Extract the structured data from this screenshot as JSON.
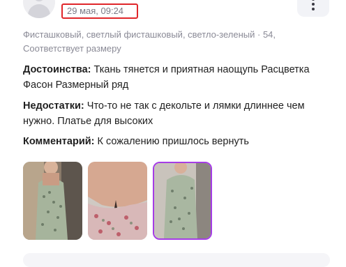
{
  "review": {
    "date": "29 мая, 09:24",
    "variant": "Фисташковый, светлый фисташковый, светло-зеленый · 54, Соответствует размеру",
    "pros_label": "Достоинства:",
    "pros_text": "Ткань тянется и приятная наощупь Расцветка Фасон Размерный ряд",
    "cons_label": "Недостатки:",
    "cons_text": "Что-то не так с декольте и лямки длиннее чем нужно. Платье для высоких",
    "comment_label": "Комментарий:",
    "comment_text": "К сожалению пришлось вернуть",
    "photos": [
      {
        "icon": "review-photo-dress-front",
        "selected": false
      },
      {
        "icon": "review-photo-neckline-closeup",
        "selected": false
      },
      {
        "icon": "review-photo-dress-mirror",
        "selected": true
      }
    ]
  },
  "colors": {
    "date_highlight": "#e0262a",
    "selected_photo_border": "#a53ce6",
    "muted_text": "#8a8a96"
  },
  "icons": {
    "more": "more-vertical-icon",
    "avatar": "user-avatar-icon"
  }
}
